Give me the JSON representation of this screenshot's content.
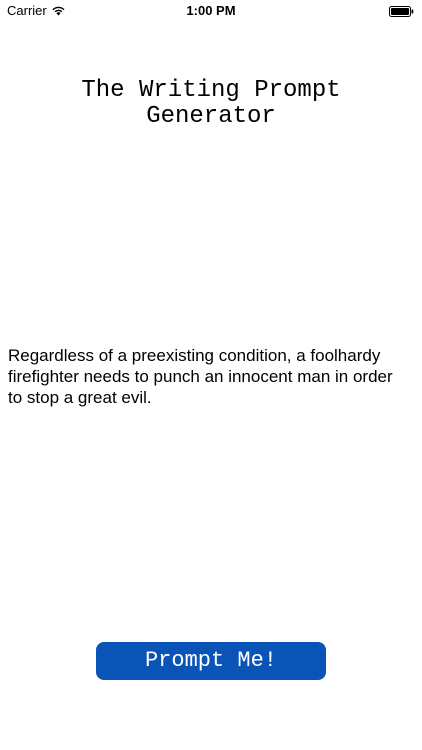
{
  "status_bar": {
    "carrier": "Carrier",
    "time": "1:00 PM",
    "wifi_icon": "wifi-icon",
    "battery_icon": "battery-full-icon"
  },
  "app": {
    "title": "The Writing Prompt\nGenerator",
    "prompt": "Regardless of a preexisting condition, a foolhardy firefighter needs to punch an innocent man in order to stop a great evil.",
    "button_label": "Prompt Me!"
  },
  "colors": {
    "button_background": "#0b54b7",
    "button_text": "#ffffff",
    "background": "#ffffff",
    "text": "#000000"
  }
}
